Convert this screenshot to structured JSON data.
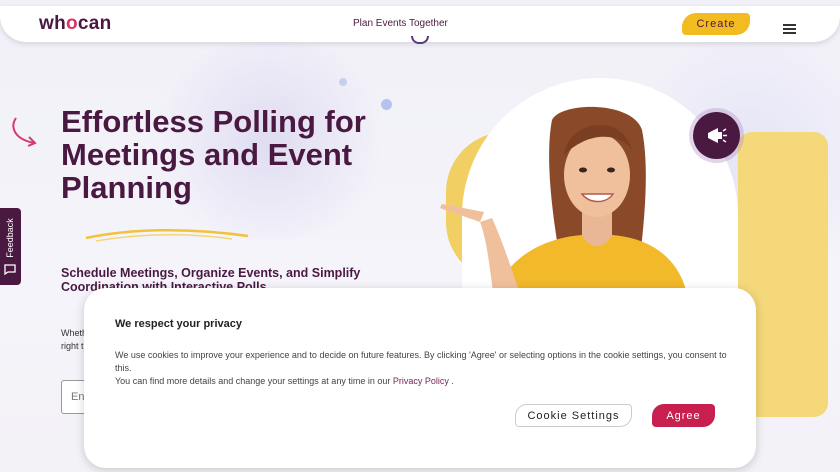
{
  "header": {
    "logo_text": "whocan",
    "logo_prefix": "wh",
    "logo_o": "o",
    "logo_suffix": "can",
    "tagline": "Plan Events Together",
    "create_label": "Create"
  },
  "hero": {
    "title": "Effortless Polling for Meetings and Event Planning",
    "subtitle": "Schedule Meetings, Organize Events, and Simplify Coordination with Interactive Polls",
    "body_fragment": "Wheth",
    "body_fragment2": "right t",
    "email_placeholder": "En"
  },
  "feedback": {
    "label": "Feedback"
  },
  "cookie": {
    "title": "We respect your privacy",
    "text_line1": "We use cookies to improve your experience and to decide on future features. By clicking 'Agree' or selecting options in the cookie settings, you consent to this.",
    "text_line2_prefix": "You can find more details and change your settings at any time in our",
    "privacy_link": "Privacy Policy",
    "text_line2_suffix": ".",
    "settings_label": "Cookie Settings",
    "agree_label": "Agree"
  },
  "colors": {
    "brand": "#4a1942",
    "accent_yellow": "#f2bb1f",
    "agree_red": "#c8204e",
    "logo_pink": "#e0306a"
  },
  "icons": [
    "hamburger-menu-icon",
    "megaphone-icon",
    "feedback-chat-icon",
    "curved-arrow-icon"
  ]
}
